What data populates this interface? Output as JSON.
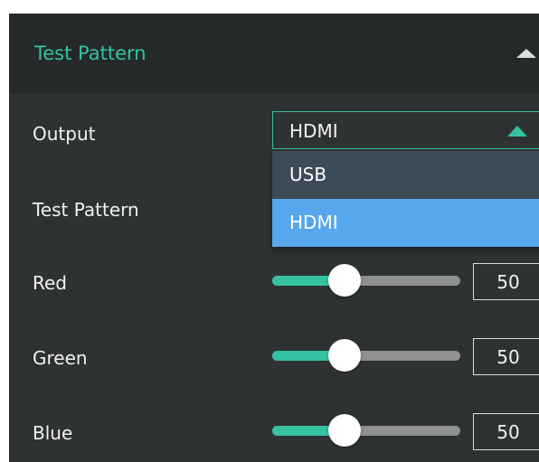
{
  "section": {
    "title": "Test Pattern",
    "collapse_icon": "triangle-up-icon"
  },
  "rows": {
    "output_label": "Output",
    "test_pattern_label": "Test Pattern",
    "red_label": "Red",
    "green_label": "Green",
    "blue_label": "Blue"
  },
  "output_select": {
    "value": "HDMI",
    "caret_icon": "triangle-up-icon",
    "options": [
      "USB",
      "HDMI"
    ],
    "highlighted_option": "HDMI"
  },
  "sliders": {
    "min": 0,
    "max": 255,
    "red": {
      "value": "50"
    },
    "green": {
      "value": "50"
    },
    "blue": {
      "value": "50"
    }
  },
  "colors": {
    "accent": "#34c2a3",
    "panel_bg": "#2f3233",
    "header_bg": "#25292a",
    "option_highlight": "#58a7ec",
    "option_bg": "#3d4a57",
    "track": "#8f9191"
  }
}
